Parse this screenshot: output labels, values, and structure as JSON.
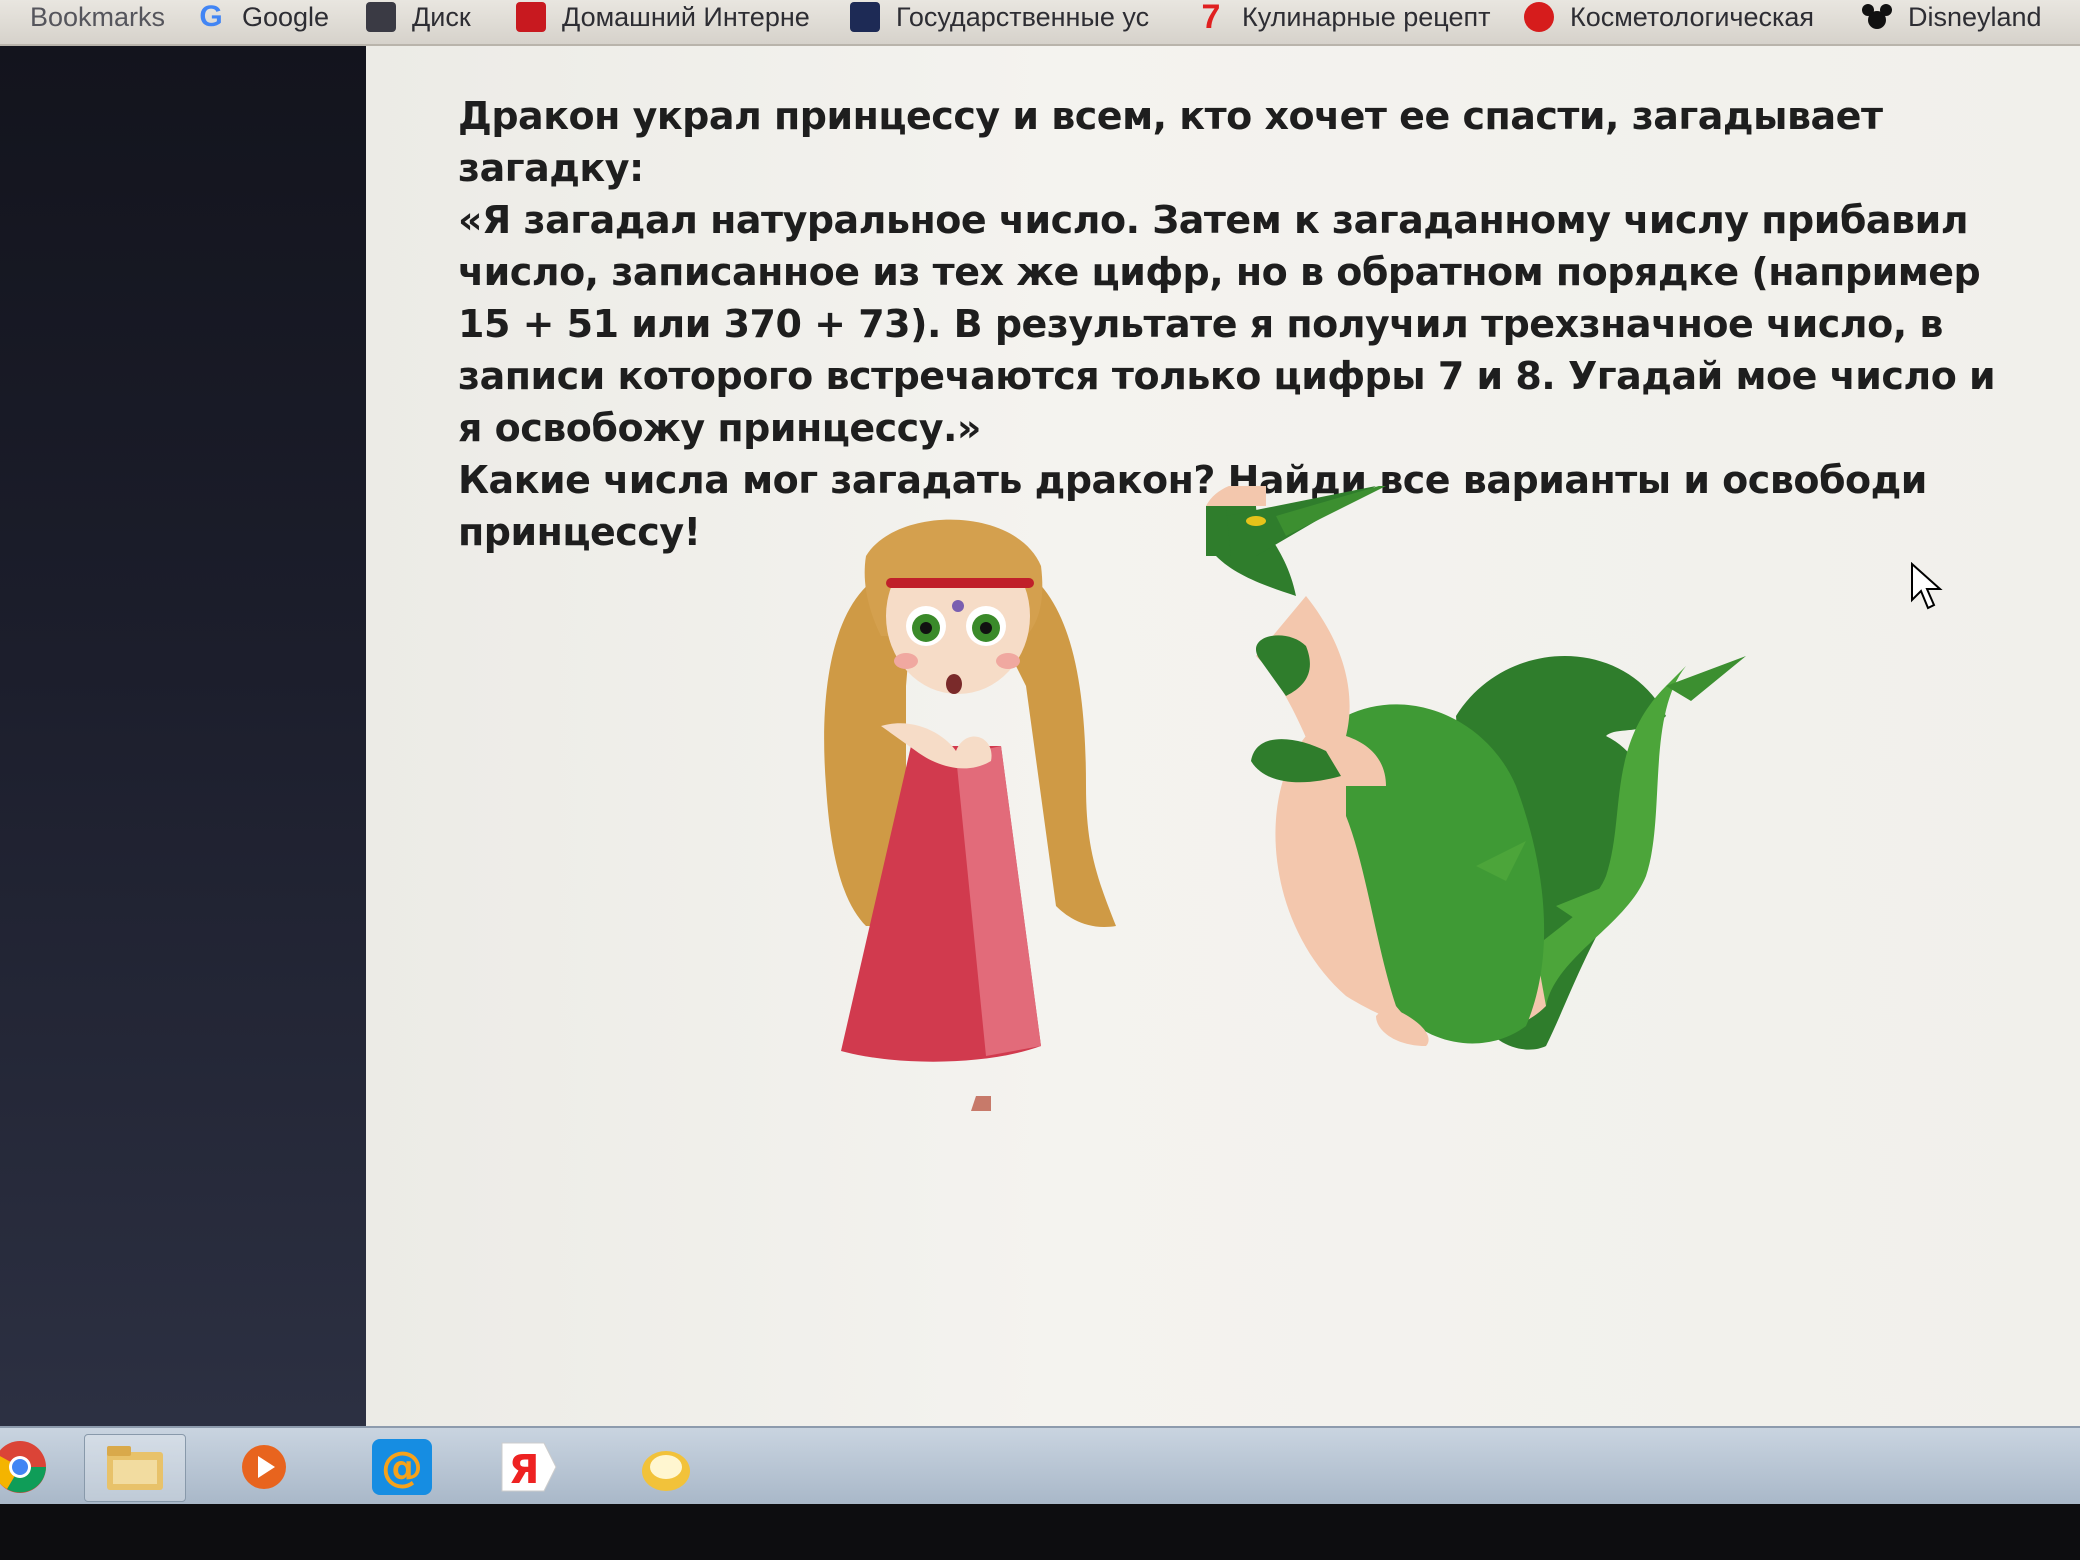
{
  "bookmarks": [
    {
      "label": "Bookmarks",
      "icon": "bookmarks-icon"
    },
    {
      "label": "Google",
      "icon": "google-icon"
    },
    {
      "label": "Диск",
      "icon": "disk-icon"
    },
    {
      "label": "Домашний Интерне",
      "icon": "home-internet-icon"
    },
    {
      "label": "Государственные ус",
      "icon": "gov-services-icon"
    },
    {
      "label": "Кулинарные рецепт",
      "icon": "recipes-icon"
    },
    {
      "label": "Косметологическая",
      "icon": "cosmetology-icon"
    },
    {
      "label": "Disneyland",
      "icon": "mickey-icon"
    }
  ],
  "problem": {
    "intro": "Дракон украл принцессу и всем, кто хочет ее спасти, загадывает загадку:",
    "riddle": "«Я загадал натуральное число. Затем к загаданному числу прибавил число, записанное из тех же цифр, но в обратном порядке (например 15 + 51 или 370 + 73). В результате я получил трехзначное число, в записи которого встречаются только цифры 7 и 8. Угадай мое число и я освобожу принцессу.»",
    "question": "Какие числа мог загадать дракон? Найди все варианты и освободи принцессу!"
  },
  "taskbar": [
    {
      "name": "chrome-icon"
    },
    {
      "name": "file-explorer-icon"
    },
    {
      "name": "media-player-icon"
    },
    {
      "name": "mail-at-icon"
    },
    {
      "name": "yandex-icon"
    },
    {
      "name": "misc-app-icon"
    }
  ]
}
